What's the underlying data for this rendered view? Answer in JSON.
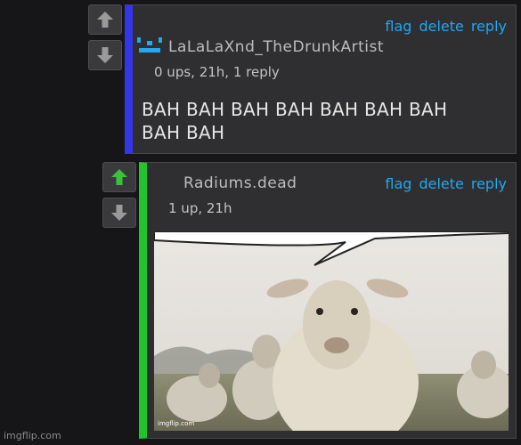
{
  "comment1": {
    "username": "LaLaLaXnd_TheDrunkArtist",
    "meta": "0 ups, 21h, 1 reply",
    "body": "BAH BAH BAH BAH BAH BAH BAH BAH BAH",
    "actions": {
      "flag": "flag",
      "delete": "delete",
      "reply": "reply"
    },
    "accent_color": "#3535e8",
    "upvoted": false
  },
  "comment2": {
    "username": "Radiums.dead",
    "meta": "1 up, 21h",
    "actions": {
      "flag": "flag",
      "delete": "delete",
      "reply": "reply"
    },
    "accent_color": "#21c42b",
    "upvoted": true,
    "image": {
      "subject": "sheep with empty speech bubble",
      "caption": "imgflip.com"
    }
  },
  "footer": {
    "watermark": "imgflip.com"
  },
  "icons": {
    "upvote": "arrow-up-icon",
    "downvote": "arrow-down-icon",
    "user_badge": "user-badge-icon"
  },
  "colors": {
    "link": "#22a7f0",
    "upvote_active": "#3bc23b",
    "arrow_idle": "#9a9a9a"
  }
}
